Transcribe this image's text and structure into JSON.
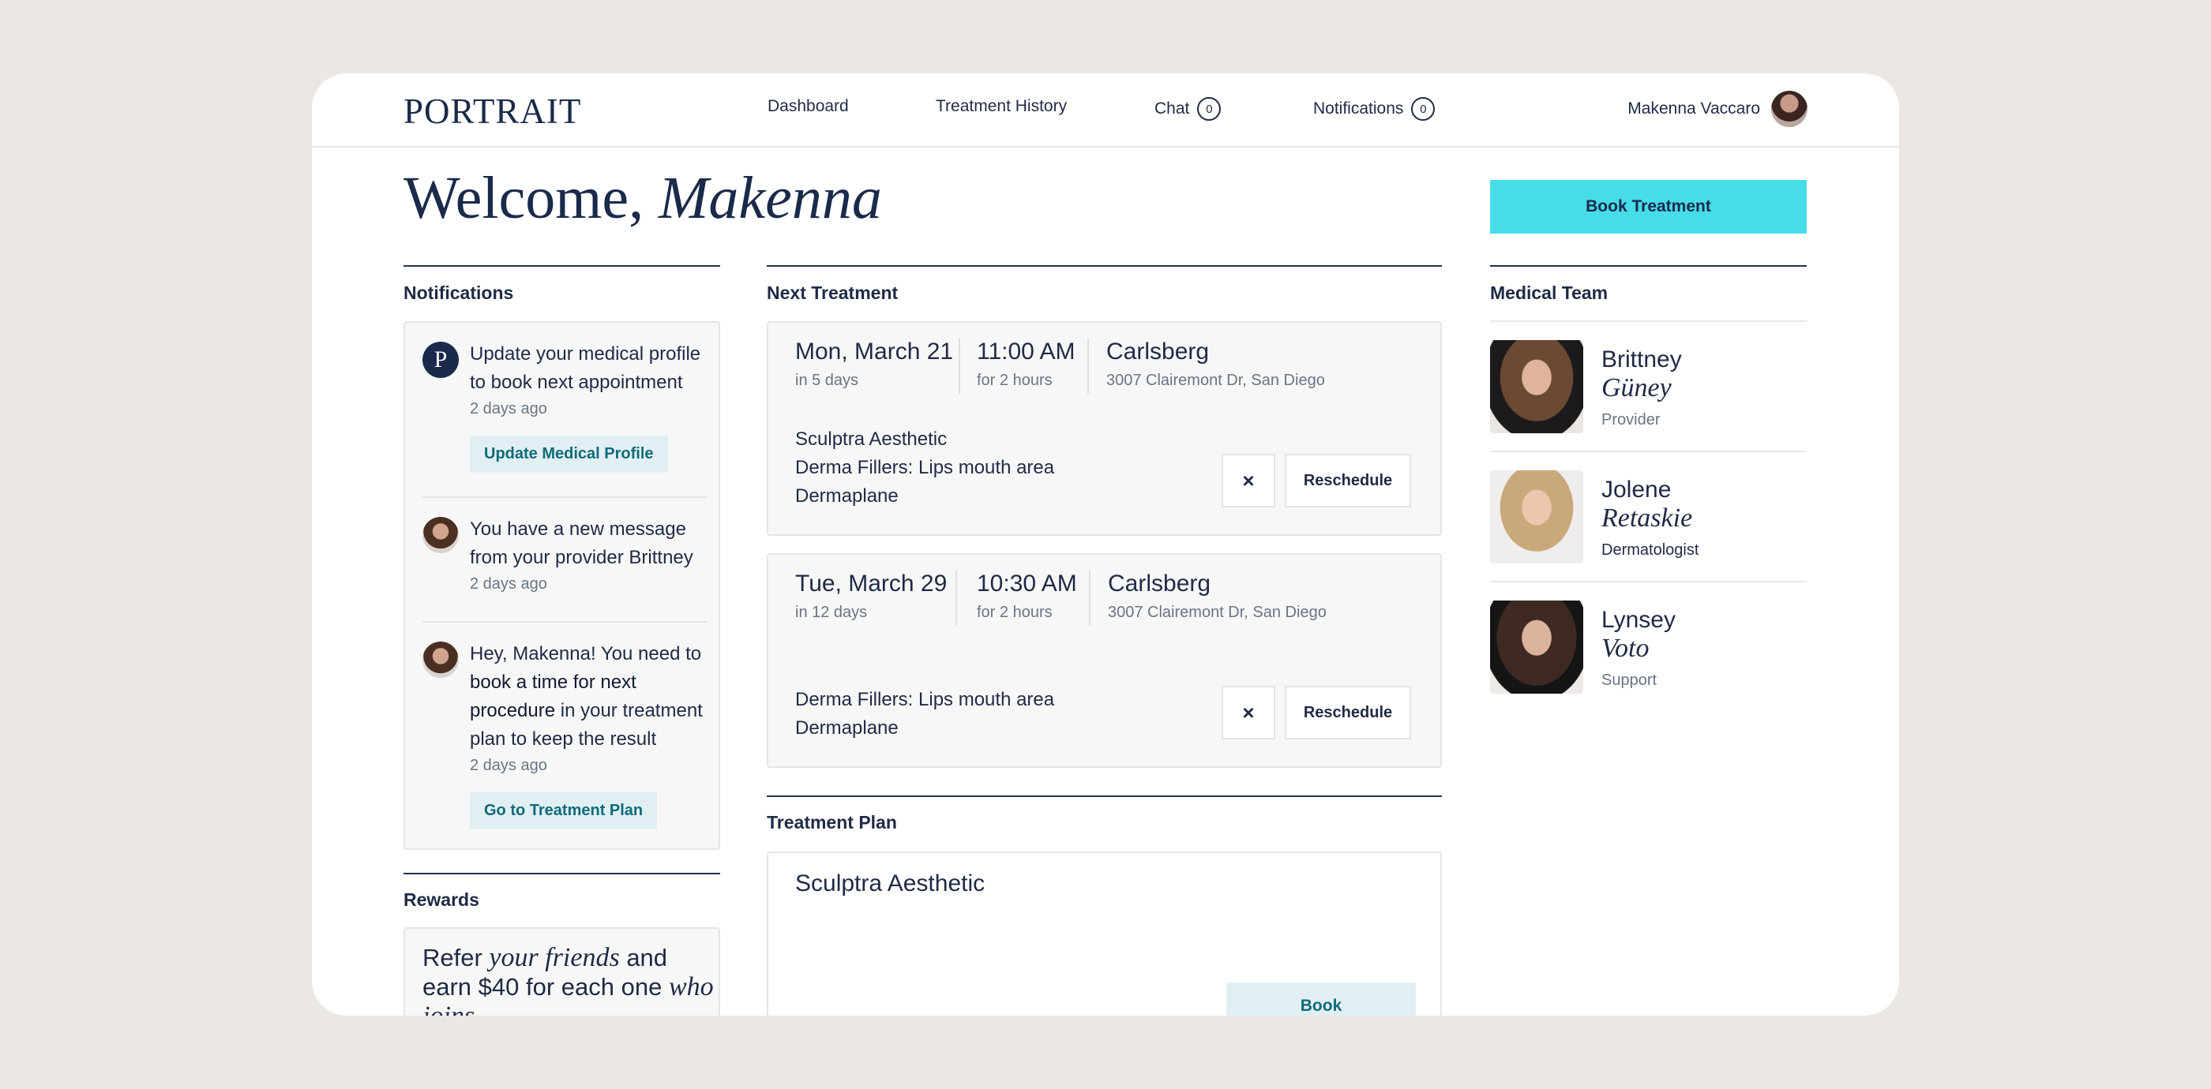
{
  "header": {
    "logo": "PORTRAIT",
    "nav": [
      {
        "label": "Dashboard"
      },
      {
        "label": "Treatment History"
      },
      {
        "label": "Chat",
        "count": "0"
      },
      {
        "label": "Notifications",
        "count": "0"
      }
    ],
    "user_name": "Makenna Vaccaro"
  },
  "welcome": {
    "prefix": "Welcome,",
    "name": "Makenna"
  },
  "book_treatment_label": "Book Treatment",
  "notifications": {
    "title": "Notifications",
    "items": [
      {
        "text": "Update your medical profile to book next appointment",
        "time": "2 days ago",
        "action": "Update Medical Profile"
      },
      {
        "text": "You have a new message from your provider Brittney",
        "time": "2 days ago"
      },
      {
        "text_start": "Hey, Makenna! You need to ",
        "text_bold": "book a time for next procedure",
        "text_end": " in your treatment plan to keep the result",
        "time": "2 days ago",
        "action": "Go to Treatment Plan"
      }
    ]
  },
  "rewards": {
    "title": "Rewards",
    "t1": "Refer ",
    "t2": "your friends",
    "t3": " and earn $40 for each one ",
    "t4": "who joins"
  },
  "next_treatment": {
    "title": "Next Treatment",
    "appointments": [
      {
        "date": "Mon, March 21",
        "relative": "in 5 days",
        "time": "11:00 AM",
        "duration": "for 2 hours",
        "location": "Carlsberg",
        "address": "3007 Clairemont Dr, San Diego",
        "treatments": [
          "Sculptra Aesthetic",
          "Derma Fillers: Lips mouth area",
          "Dermaplane"
        ],
        "cancel": "×",
        "reschedule": "Reschedule"
      },
      {
        "date": "Tue, March 29",
        "relative": "in 12 days",
        "time": "10:30 AM",
        "duration": "for 2 hours",
        "location": "Carlsberg",
        "address": "3007 Clairemont Dr, San Diego",
        "treatments": [
          "Derma Fillers: Lips mouth area",
          "Dermaplane"
        ],
        "cancel": "×",
        "reschedule": "Reschedule"
      }
    ]
  },
  "treatment_plan": {
    "title": "Treatment Plan",
    "item": "Sculptra Aesthetic",
    "book_label": "Book"
  },
  "medical_team": {
    "title": "Medical Team",
    "members": [
      {
        "first": "Brittney",
        "last": "Güney",
        "role": "Provider"
      },
      {
        "first": "Jolene",
        "last": "Retaskie",
        "role": "Dermatologist"
      },
      {
        "first": "Lynsey",
        "last": "Voto",
        "role": "Support"
      }
    ]
  }
}
